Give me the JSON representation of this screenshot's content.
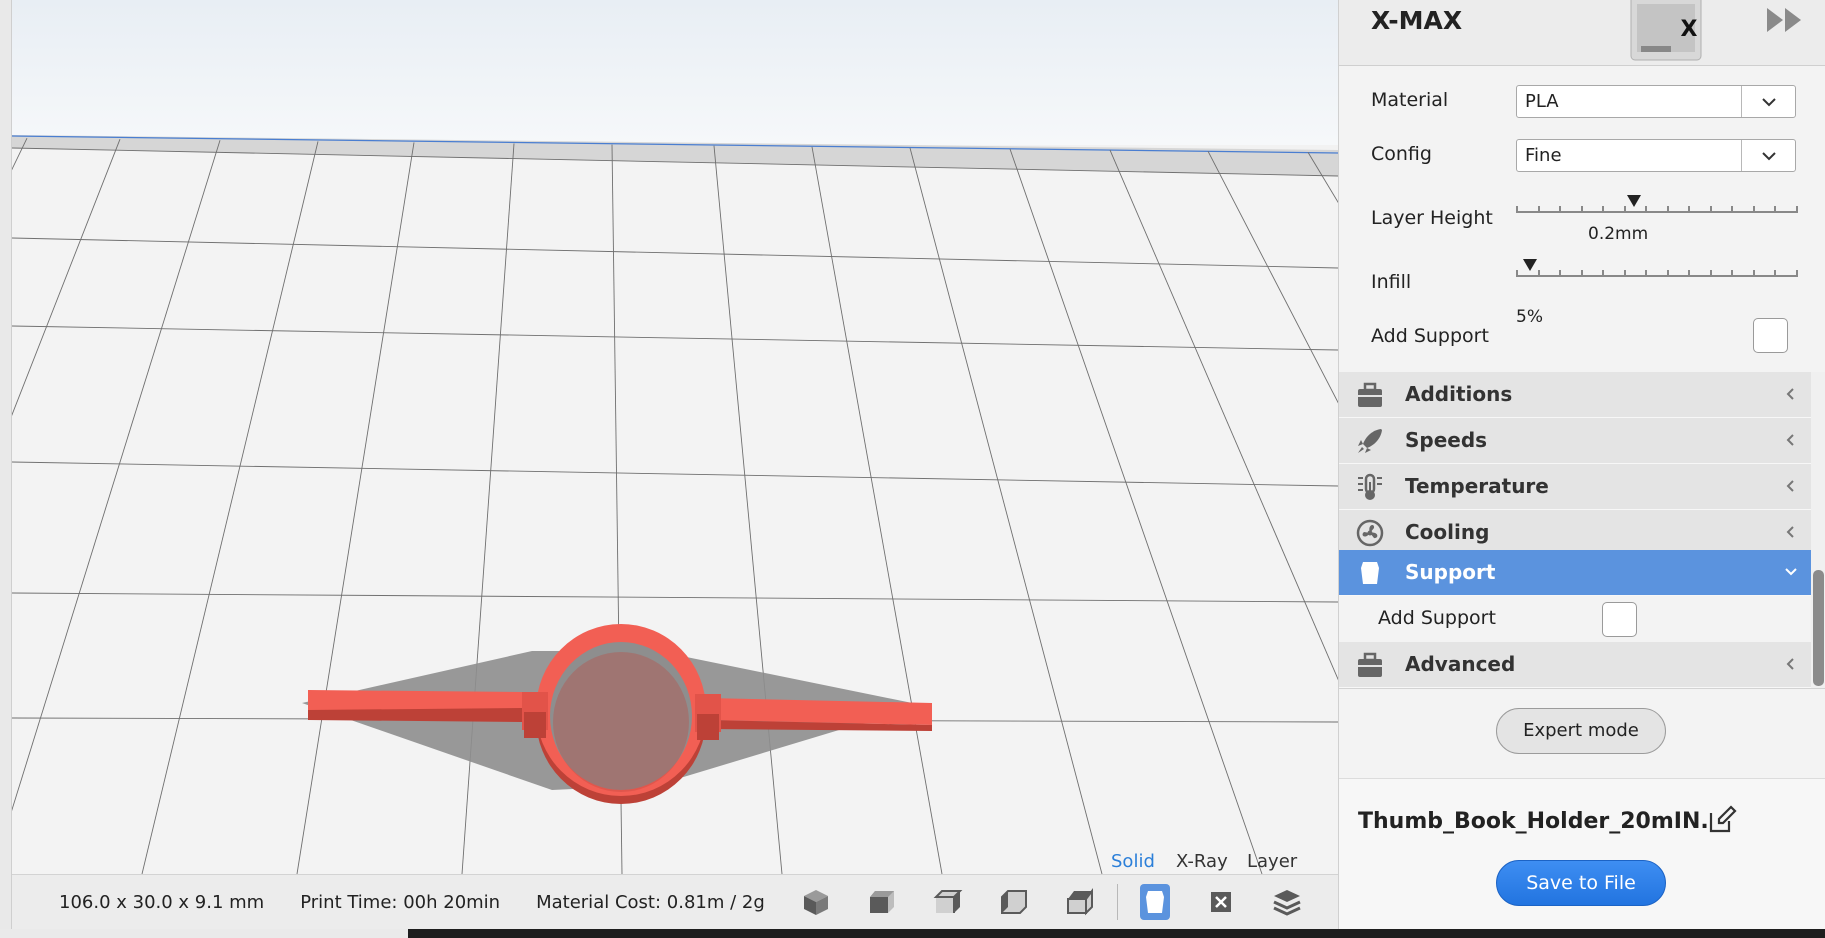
{
  "viewport": {
    "view_modes": {
      "solid": "Solid",
      "xray": "X-Ray",
      "layer": "Layer"
    },
    "active_mode_color": "#2b7fd9",
    "model_color": "#f25f54",
    "shadow_color": "#8e8e8e"
  },
  "status_bar": {
    "dimensions": "106.0 x 30.0 x 9.1 mm",
    "print_time_label": "Print Time:",
    "print_time_value": "00h 20min",
    "material_cost_label": "Material Cost:",
    "material_cost_value": "0.81m / 2g",
    "view_buttons": [
      "iso-view-icon",
      "front-view-icon",
      "left-view-icon",
      "right-view-icon",
      "top-view-icon",
      "solid-mode-icon",
      "xray-mode-icon",
      "layer-mode-icon"
    ]
  },
  "panel": {
    "printer_name": "X-MAX",
    "printer_badge": "X",
    "material": {
      "label": "Material",
      "value": "PLA"
    },
    "config": {
      "label": "Config",
      "value": "Fine"
    },
    "layer_height": {
      "label": "Layer Height",
      "value": "0.2mm",
      "position": 0.42
    },
    "infill": {
      "label": "Infill",
      "value": "5%",
      "position": 0.05
    },
    "add_support": {
      "label": "Add Support",
      "checked": false
    },
    "sections": [
      {
        "label": "Additions",
        "icon": "toolbox-icon",
        "expanded": false
      },
      {
        "label": "Speeds",
        "icon": "rocket-icon",
        "expanded": false
      },
      {
        "label": "Temperature",
        "icon": "thermometer-icon",
        "expanded": false
      },
      {
        "label": "Cooling",
        "icon": "fan-icon",
        "expanded": false
      },
      {
        "label": "Support",
        "icon": "support-icon",
        "expanded": true
      },
      {
        "label": "Advanced",
        "icon": "toolbox-icon",
        "expanded": false
      }
    ],
    "support_sub": {
      "label": "Add Support",
      "checked": false
    },
    "expert_mode_label": "Expert mode",
    "file_name": "Thumb_Book_Holder_20mIN.",
    "save_label": "Save to File",
    "accent_color": "#5b93de",
    "save_color": "#2f80ea"
  }
}
